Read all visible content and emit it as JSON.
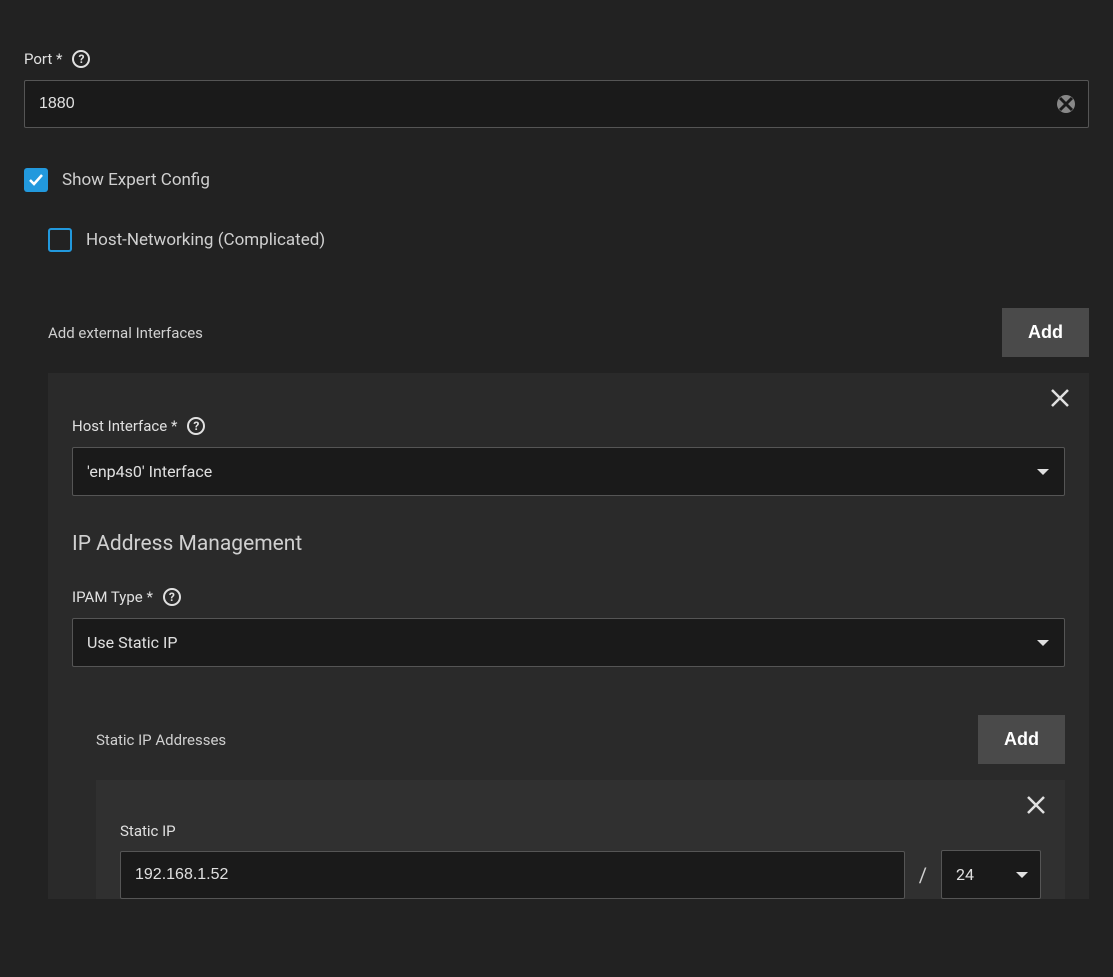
{
  "port": {
    "label": "Port *",
    "value": "1880"
  },
  "expert": {
    "show_label": "Show Expert Config",
    "host_networking_label": "Host-Networking (Complicated)"
  },
  "interfaces": {
    "add_label": "Add external Interfaces",
    "add_button": "Add",
    "host_interface_label": "Host Interface *",
    "host_interface_value": "'enp4s0' Interface",
    "ipam_heading": "IP Address Management",
    "ipam_type_label": "IPAM Type *",
    "ipam_type_value": "Use Static IP",
    "static": {
      "section_label": "Static IP Addresses",
      "add_button": "Add",
      "ip_label": "Static IP",
      "ip_value": "192.168.1.52",
      "slash": "/",
      "mask": "24"
    }
  }
}
